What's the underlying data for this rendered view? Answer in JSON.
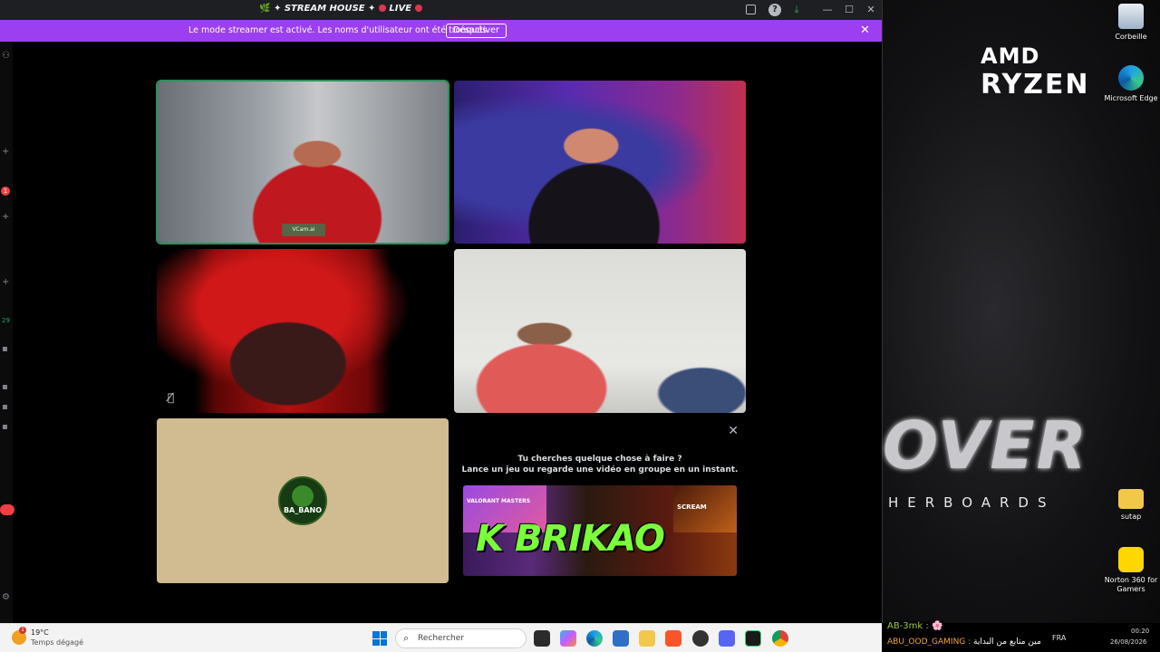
{
  "window": {
    "title": "STREAM HOUSE",
    "title_prefix": "🌿 ✦ ",
    "title_mid": " ✦ ",
    "live_label": "LIVE"
  },
  "streamer_banner": {
    "message": "Le mode streamer est activé. Les noms d'utilisateur ont été tronqués.",
    "button_label": "Désactiver"
  },
  "rail": {
    "badge_count": "1",
    "channel_count": "29"
  },
  "tiles": [
    {
      "type": "video",
      "speaking": true,
      "overlay_label": "VCam.ai"
    },
    {
      "type": "video",
      "speaking": false
    },
    {
      "type": "video",
      "speaking": false,
      "muted": true
    },
    {
      "type": "video",
      "speaking": false
    },
    {
      "type": "avatar",
      "avatar_text": "BA_BANO",
      "background": "#d1bb90"
    }
  ],
  "activity_panel": {
    "line1": "Tu cherches quelque chose à faire ?",
    "line2": "Lance un jeu ou regarde une vidéo en groupe en un instant.",
    "game1": "VALORANT MASTERS",
    "game3": "SCREAM",
    "logo_text": "BRIKAO",
    "logo_letter": "K"
  },
  "desktop": {
    "amd": "AMD",
    "ryzen": "RYZEN",
    "wallpaper_big": "OVER",
    "wallpaper_small": "HERBOARDS",
    "icons": [
      {
        "label": "Corbeille",
        "icon": "recycle-bin-icon"
      },
      {
        "label": "Microsoft Edge",
        "icon": "edge-icon"
      },
      {
        "label": "sutap",
        "icon": "folder-icon"
      },
      {
        "label": "Norton 360 for Gamers",
        "icon": "norton-icon"
      }
    ],
    "chat": [
      {
        "user": "AB-3mk :",
        "text": ""
      },
      {
        "user": "ABU_OOD_GAMING :",
        "text": "مين متابع من البداية"
      }
    ]
  },
  "taskbar": {
    "weather_badge": "1",
    "temperature": "19°C",
    "condition": "Temps dégagé",
    "search_placeholder": "Rechercher",
    "language": "FRA",
    "time": "00:20",
    "date": "26/08/2026"
  },
  "colors": {
    "banner": "#9b3ff0",
    "speaking_outline": "#2f8f5a",
    "live_dot": "#e1344f",
    "taskbar": "#f3f3f3"
  }
}
